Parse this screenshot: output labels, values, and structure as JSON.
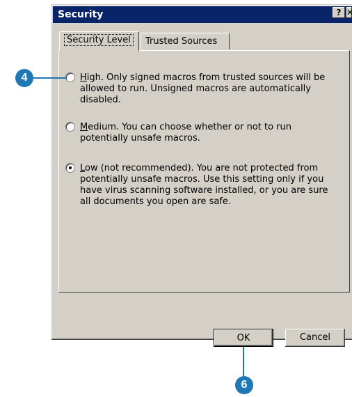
{
  "dialog": {
    "title": "Security",
    "help_glyph": "?",
    "close_glyph": "✕"
  },
  "tabs": [
    {
      "label": "Security Level",
      "active": true
    },
    {
      "label": "Trusted Sources",
      "active": false
    }
  ],
  "options": [
    {
      "mnemonic": "H",
      "rest": "igh. Only signed macros from trusted sources will be allowed to run. Unsigned macros are automatically disabled.",
      "selected": false
    },
    {
      "mnemonic": "M",
      "rest": "edium. You can choose whether or not to run potentially unsafe macros.",
      "selected": false
    },
    {
      "mnemonic": "L",
      "rest": "ow (not recommended). You are not protected from potentially unsafe macros. Use this setting only if you have virus scanning software installed, or you are sure all documents you open are safe.",
      "selected": true
    }
  ],
  "buttons": {
    "ok": "OK",
    "cancel": "Cancel"
  },
  "callouts": {
    "high_option": "4",
    "ok_button": "6"
  },
  "colors": {
    "titlebar": "#0a246a",
    "callout": "#1f78b4",
    "dialog_face": "#d4d0c8"
  }
}
